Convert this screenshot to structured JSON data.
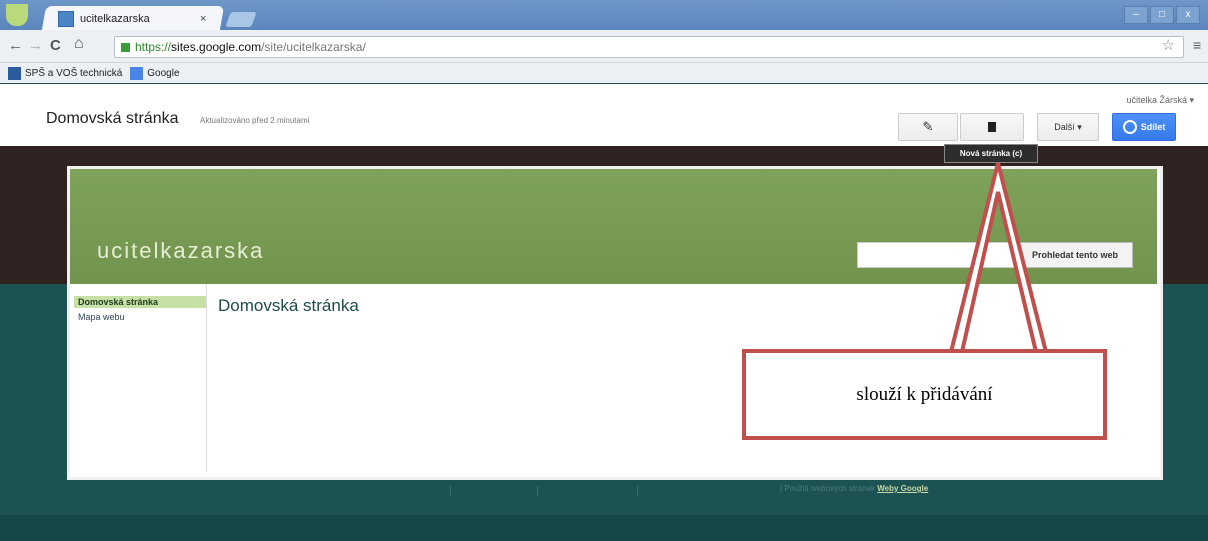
{
  "browser": {
    "tab_title": "ucitelkazarska",
    "tab_close": "×",
    "window_controls": [
      "–",
      "□",
      "x"
    ],
    "nav": {
      "back": "←",
      "forward": "→",
      "reload": "C",
      "home": "⌂"
    },
    "url": {
      "protocol": "https://",
      "host": "sites.google.com",
      "path": "/site/ucitelkazarska/"
    },
    "star": "☆",
    "menu": "≡",
    "bookmarks": [
      {
        "label": "SPŠ a VOŠ technická",
        "icon": "school-icon",
        "color": "#2b5c9e"
      },
      {
        "label": "Google",
        "icon": "google-icon",
        "color": "#4a86e8"
      }
    ]
  },
  "sites_header": {
    "user": "učitelka Žárská ▾",
    "page_title": "Domovská stránka",
    "updated": "Aktualizováno před 2 minutami",
    "edit_icon": "pencil-icon",
    "new_page_icon": "new-page-icon",
    "more_label": "Další ▾",
    "share_label": "Sdílet",
    "tooltip": "Nová stránka (c)"
  },
  "site": {
    "name": "ucitelkazarska",
    "search_button": "Prohledat tento web",
    "sidebar": [
      "Domovská stránka",
      "Mapa webu"
    ],
    "content_title": "Domovská stránka",
    "footer_prefix": "| Použití webových stránek",
    "footer_link": "Weby Google"
  },
  "annotation": {
    "text": "slouží k přidávání",
    "color": "#c0504d"
  }
}
